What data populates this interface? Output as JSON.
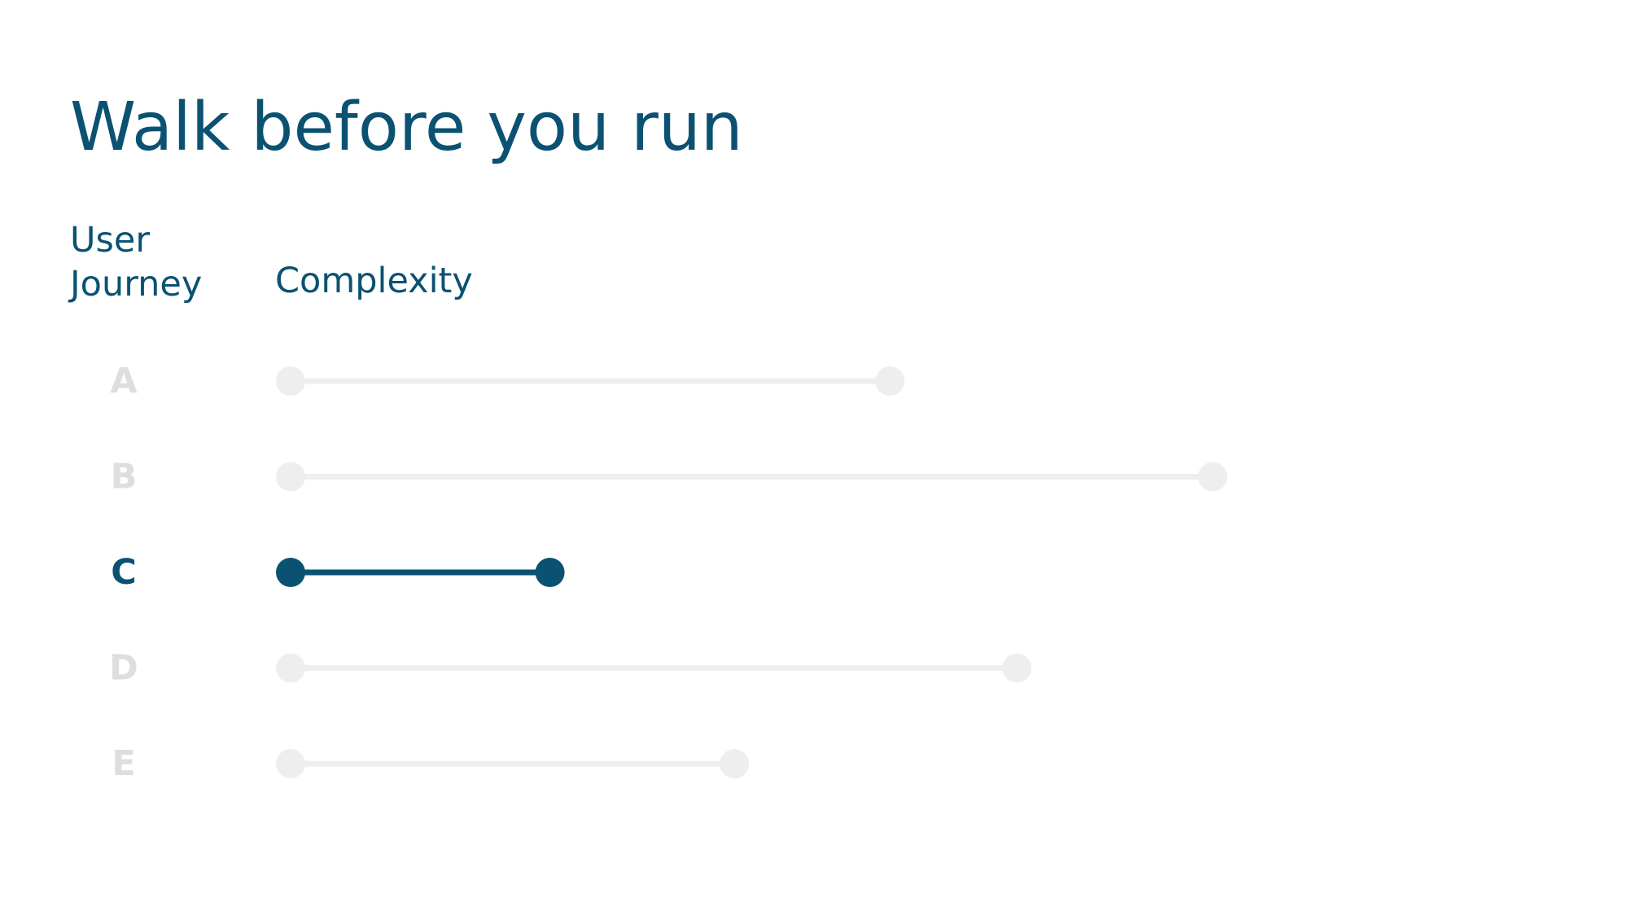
{
  "title": "Walk before you run",
  "headers": {
    "journey_line1": "User",
    "journey_line2": "Journey",
    "complexity": "Complexity"
  },
  "colors": {
    "highlight": "#0b5272",
    "muted_track": "#eeeeee",
    "muted_label": "#dedede"
  },
  "chart_data": {
    "type": "dumbbell",
    "categories": [
      "A",
      "B",
      "C",
      "D",
      "E"
    ],
    "start": [
      0,
      0,
      0,
      0,
      0
    ],
    "values": [
      52,
      80,
      22.5,
      63,
      38.5
    ],
    "xlim": [
      0,
      100
    ],
    "highlighted": "C",
    "grid": false,
    "legend": "none"
  }
}
